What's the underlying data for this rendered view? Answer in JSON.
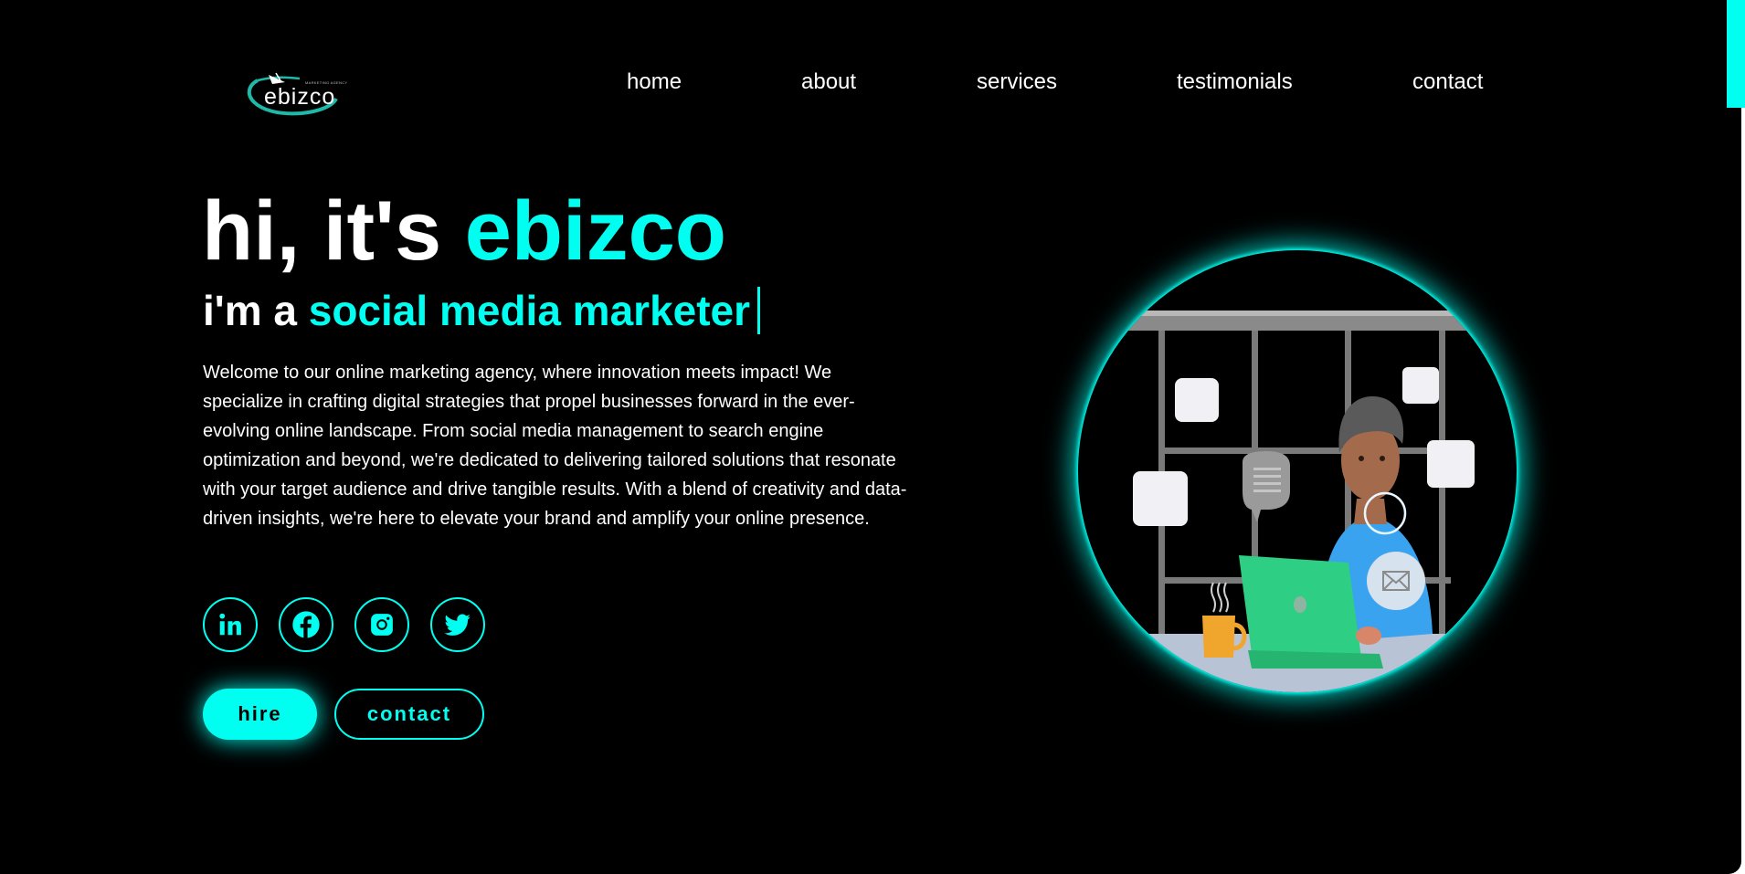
{
  "brand": {
    "name": "ebizco",
    "tagline": "MARKETING AGENCY",
    "accent_color": "#00fff0",
    "background_color": "#000000"
  },
  "nav": {
    "items": [
      {
        "label": "home"
      },
      {
        "label": "about"
      },
      {
        "label": "services"
      },
      {
        "label": "testimonials"
      },
      {
        "label": "contact"
      }
    ]
  },
  "hero": {
    "title_prefix": "hi, it's ",
    "title_accent": "ebizco",
    "subtitle_prefix": "i'm a ",
    "subtitle_accent": "social media marketer",
    "description": "Welcome to our online marketing agency, where innovation meets impact! We specialize in crafting digital strategies that propel businesses forward in the ever-evolving online landscape. From social media management to search engine optimization and beyond, we're dedicated to delivering tailored solutions that resonate with your target audience and drive tangible results. With a blend of creativity and data-driven insights, we're here to elevate your brand and amplify your online presence."
  },
  "socials": [
    {
      "icon": "linkedin-icon"
    },
    {
      "icon": "facebook-icon"
    },
    {
      "icon": "instagram-icon"
    },
    {
      "icon": "twitter-icon"
    }
  ],
  "buttons": {
    "hire_label": "hire",
    "contact_label": "contact"
  },
  "illustration": {
    "icon": "marketer-at-laptop-illustration"
  }
}
